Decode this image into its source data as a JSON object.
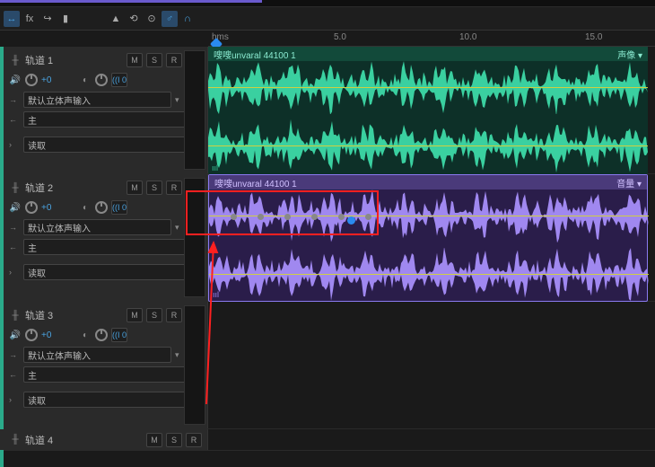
{
  "ruler": {
    "unit": "hms",
    "marks": [
      "5.0",
      "10.0",
      "15.0"
    ]
  },
  "tools": [
    "↔",
    "fx",
    "↪",
    "▮",
    "⫶",
    "▲",
    "⟲",
    "⊙",
    "♂",
    "∩"
  ],
  "tracks": [
    {
      "name": "轨道 1",
      "mute": "M",
      "solo": "S",
      "rec": "R",
      "vol": "+0",
      "pan": "0",
      "input": "默认立体声输入",
      "output": "主",
      "mode": "读取",
      "clip": {
        "label": "嗖嗖unvaral 44100 1",
        "side": "声像",
        "color": "green"
      },
      "stripe": "#2aaa8a"
    },
    {
      "name": "轨道 2",
      "mute": "M",
      "solo": "S",
      "rec": "R",
      "vol": "+0",
      "pan": "0",
      "input": "默认立体声输入",
      "output": "主",
      "mode": "读取",
      "clip": {
        "label": "嗖嗖unvaral 44100 1",
        "side": "音量",
        "color": "purple"
      },
      "stripe": "#9a7af0"
    },
    {
      "name": "轨道 3",
      "mute": "M",
      "solo": "S",
      "rec": "R",
      "vol": "+0",
      "pan": "0",
      "input": "默认立体声输入",
      "output": "主",
      "mode": "读取",
      "stripe": "#d0a040"
    },
    {
      "name": "轨道 4",
      "mute": "M",
      "solo": "S",
      "rec": "R",
      "stripe": "#2aaa8a",
      "collapsed": true
    }
  ]
}
